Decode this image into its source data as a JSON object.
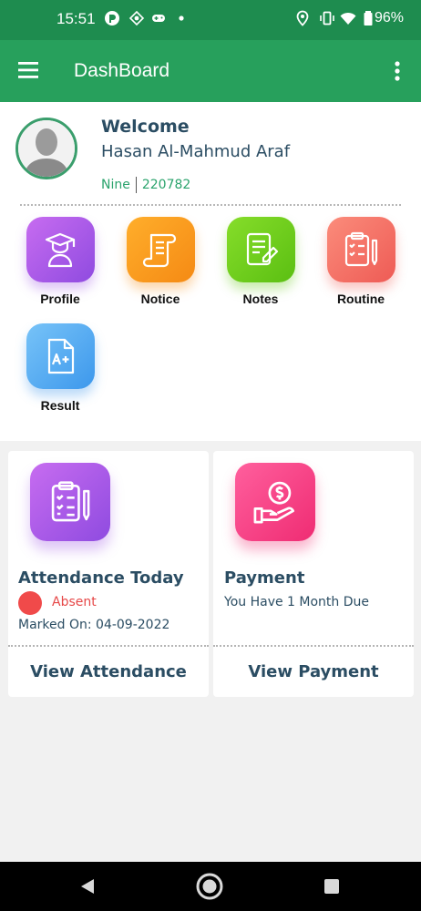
{
  "status_bar": {
    "time": "15:51",
    "battery": "96%",
    "icons": [
      "pocket-icon",
      "chess-icon",
      "gamepad-icon",
      "dot-icon",
      "location-icon",
      "vibrate-icon",
      "wifi-icon",
      "battery-icon"
    ]
  },
  "app_bar": {
    "title": "DashBoard",
    "menu_icon": "hamburger-menu-icon",
    "more_icon": "more-vert-icon",
    "color": "#27a05c"
  },
  "profile": {
    "welcome": "Welcome",
    "name": "Hasan Al-Mahmud Araf",
    "class": "Nine",
    "id": "220782"
  },
  "tiles": [
    {
      "label": "Profile",
      "icon": "graduate-icon",
      "color": "#a259e8"
    },
    {
      "label": "Notice",
      "icon": "scroll-icon",
      "color": "#f7941d"
    },
    {
      "label": "Notes",
      "icon": "notes-edit-icon",
      "color": "#6bcc1a"
    },
    {
      "label": "Routine",
      "icon": "clipboard-icon",
      "color": "#f46d62"
    },
    {
      "label": "Result",
      "icon": "grade-file-icon",
      "color": "#4aa6ef"
    }
  ],
  "attendance": {
    "title": "Attendance Today",
    "status": "Absent",
    "marked_on": "Marked On: 04-09-2022",
    "action": "View Attendance",
    "status_color": "#f04a4a"
  },
  "payment": {
    "title": "Payment",
    "due": "You Have 1 Month Due",
    "action": "View Payment"
  },
  "nav_bar": {
    "back_icon": "back-triangle-icon",
    "home_icon": "home-circle-icon",
    "recents_icon": "recents-square-icon"
  }
}
